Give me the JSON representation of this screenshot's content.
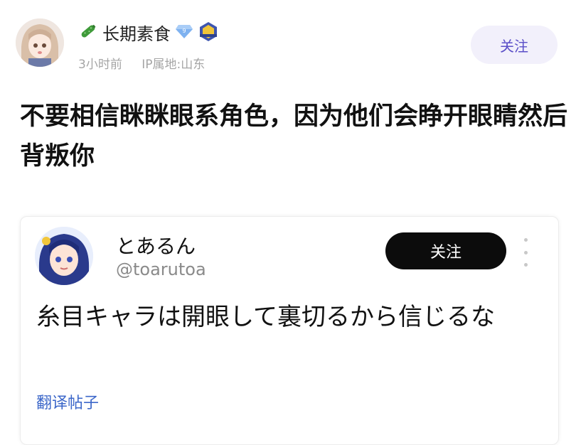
{
  "post": {
    "author": {
      "name": "长期素食",
      "badges": [
        "cucumber-icon",
        "diamond-badge-icon",
        "level-badge-icon"
      ]
    },
    "time": "3小时前",
    "ip_location": "IP属地:山东",
    "follow_label": "关注",
    "text": "不要相信眯眯眼系角色，因为他们会睁开眼睛然后背叛你"
  },
  "quote": {
    "name": "とあるん",
    "handle": "@toarutoa",
    "follow_label": "关注",
    "text": "糸目キャラは開眼して裏切るから信じるな",
    "translate_label": "翻译帖子"
  },
  "colors": {
    "accent": "#5b4fc8",
    "follow_bg": "#f2f0fb",
    "link": "#3c67c9",
    "dark_button": "#0c0c0c"
  }
}
